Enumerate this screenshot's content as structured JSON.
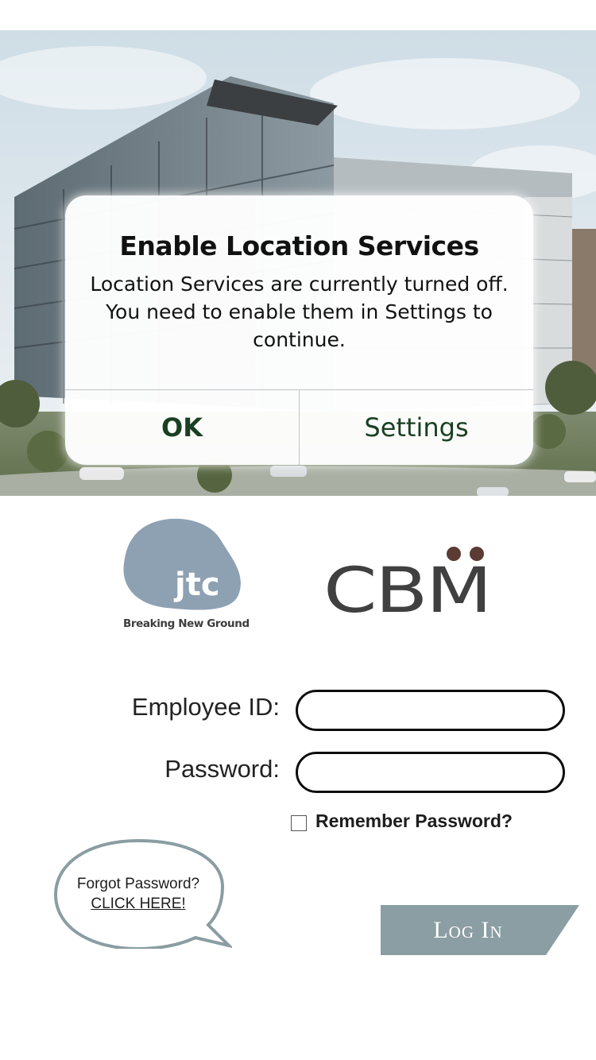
{
  "alert": {
    "title": "Enable Location Services",
    "message": "Location Services are currently turned off. You need to enable them in Settings to continue.",
    "ok_label": "OK",
    "settings_label": "Settings"
  },
  "logos": {
    "jtc_text": "jtc",
    "jtc_tagline": "Breaking New Ground",
    "cbm_text": "CBM"
  },
  "form": {
    "employee_id_label": "Employee ID:",
    "employee_id_value": "",
    "password_label": "Password:",
    "password_value": "",
    "remember_label": "Remember Password?",
    "remember_checked": false
  },
  "forgot": {
    "line1": "Forgot Password?",
    "line2": "CLICK HERE!"
  },
  "login": {
    "label": "Log In",
    "color": "#8b9ea3"
  },
  "colors": {
    "jtc_blob": "#8ea1b3",
    "cbm_dots": "#5b3b33",
    "alert_button_text": "#1a3f22"
  }
}
